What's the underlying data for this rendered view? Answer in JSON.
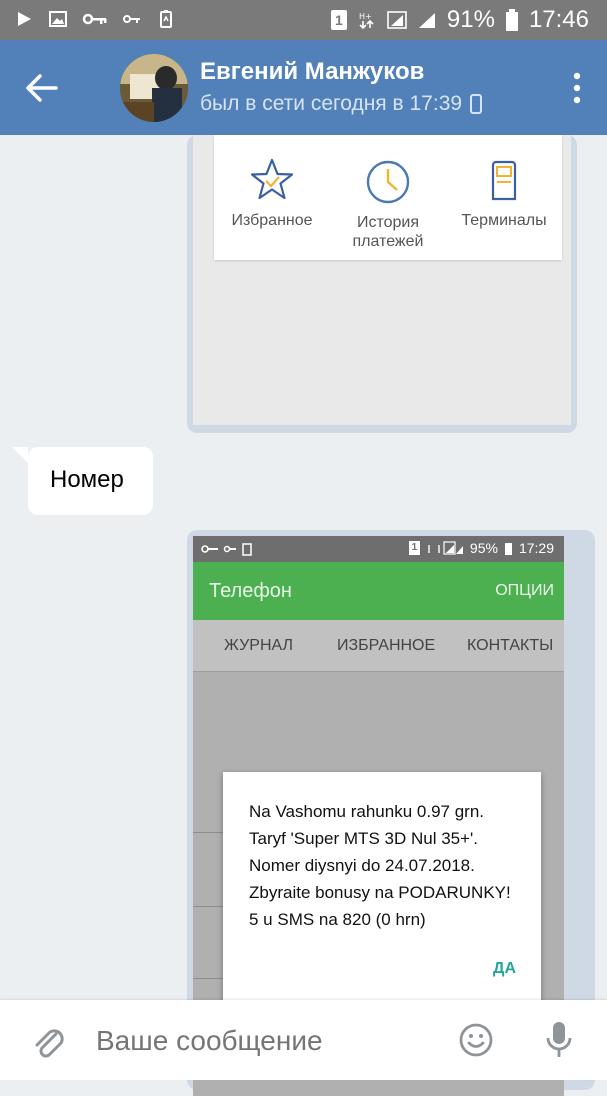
{
  "status_bar": {
    "battery_percent": "91%",
    "time": "17:46",
    "sim": "1"
  },
  "header": {
    "contact_name": "Евгений Манжуков",
    "last_seen": "был в сети сегодня в 17:39"
  },
  "messages": {
    "card_menu": {
      "items": [
        {
          "label": "Избранное",
          "icon": "star-icon"
        },
        {
          "label": "История\nплатежей",
          "icon": "clock-icon"
        },
        {
          "label": "Терминалы",
          "icon": "terminal-icon"
        }
      ]
    },
    "incoming_text": "Номер",
    "screenshot": {
      "status_battery": "95%",
      "status_time": "17:29",
      "sim": "1",
      "app_title": "Телефон",
      "app_action": "ОПЦИИ",
      "tabs": [
        "ЖУРНАЛ",
        "ИЗБРАННОЕ",
        "КОНТАКТЫ"
      ],
      "dialog_lines": [
        "Na Vashomu rahunku 0.97 grn.",
        "Taryf 'Super MTS 3D Nul 35+'.",
        "Nomer diysnyi do 24.07.2018.",
        "Zbyraite bonusy na PODARUNKY!",
        "5 u SMS na 820 (0 hrn)"
      ],
      "dialog_button": "ДА"
    }
  },
  "composer": {
    "placeholder": "Ваше сообщение"
  },
  "colors": {
    "header": "#5181b8",
    "green_app": "#4caf50",
    "accent_ok": "#26a69a",
    "star": "#3b5fa3",
    "clock": "#4a78b5",
    "terminal": "#f2b233"
  }
}
